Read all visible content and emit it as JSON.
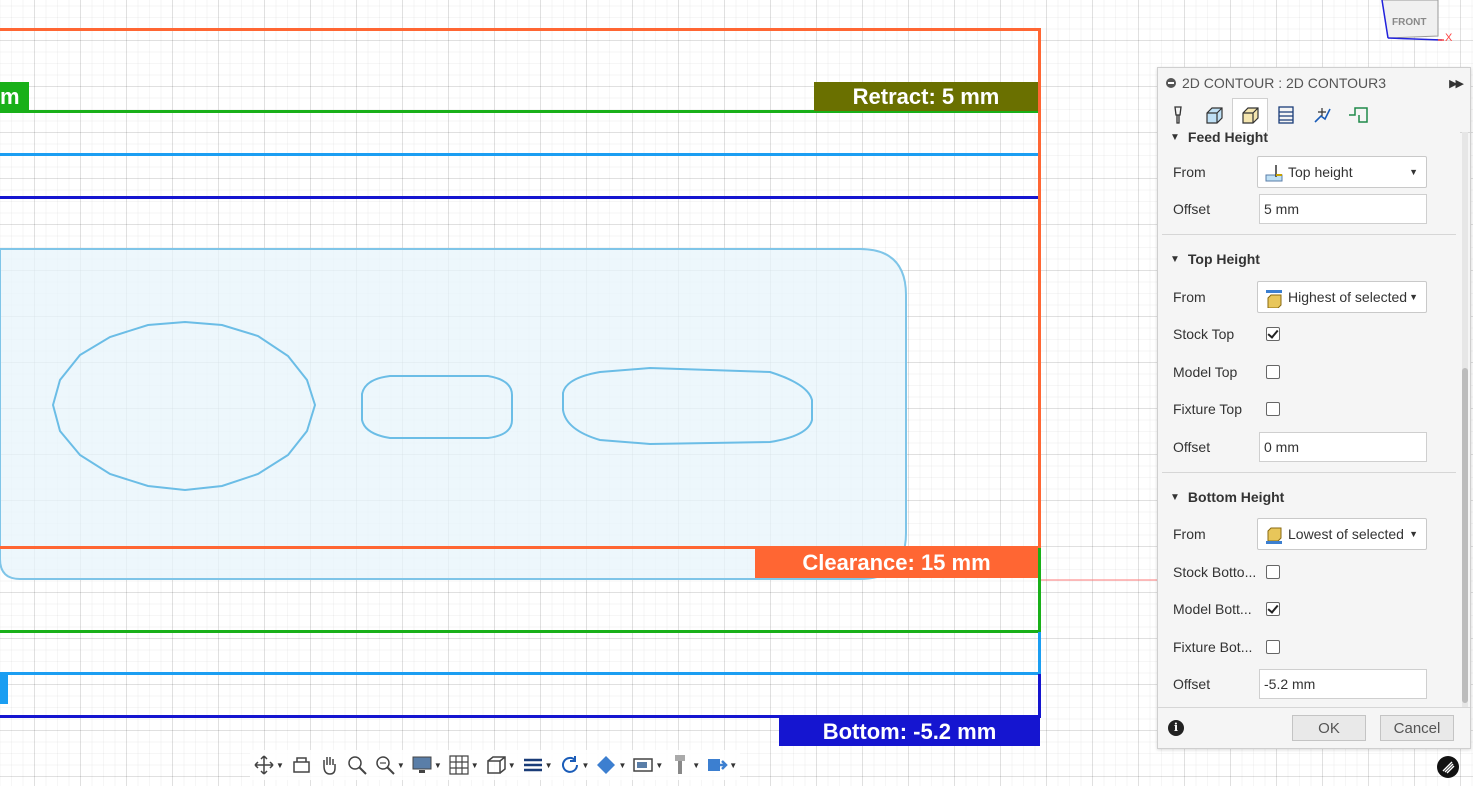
{
  "viewport": {
    "height_labels": {
      "retract": "Retract: 5 mm",
      "clearance": "Clearance: 15 mm",
      "bottom": "Bottom: -5.2 mm",
      "partial_left_top": "m"
    },
    "colors": {
      "clearance": "#ff6633",
      "retract": "#6a7000",
      "feed_green": "#19b019",
      "top_lightblue": "#1b9ef2",
      "bottom_blue": "#1515d0",
      "stock_fill": "#e7f4fb",
      "stock_stroke": "#7fc5e8"
    },
    "viewcube_label": "FRONT",
    "axis_label": "X"
  },
  "toolbar": {
    "items": [
      {
        "icon": "orbit-move-icon",
        "has_menu": true
      },
      {
        "icon": "look-at-icon",
        "has_menu": false
      },
      {
        "icon": "pan-hand-icon",
        "has_menu": false
      },
      {
        "icon": "zoom-icon",
        "has_menu": false
      },
      {
        "icon": "zoom-window-icon",
        "has_menu": true
      },
      {
        "icon": "display-settings-icon",
        "has_menu": true
      },
      {
        "icon": "grid-icon",
        "has_menu": true
      },
      {
        "icon": "viewports-icon",
        "has_menu": true
      },
      {
        "icon": "layers-icon",
        "has_menu": true
      },
      {
        "icon": "refresh-icon",
        "has_menu": true
      },
      {
        "icon": "material-icon",
        "has_menu": true
      },
      {
        "icon": "simulation-icon",
        "has_menu": true
      },
      {
        "icon": "tool-icon",
        "has_menu": true
      },
      {
        "icon": "post-icon",
        "has_menu": true
      }
    ]
  },
  "panel": {
    "title": "2D CONTOUR : 2D CONTOUR3",
    "tabs": [
      "tool-tab",
      "geometry-tab",
      "heights-tab",
      "passes-tab",
      "linking-tab",
      "post-tab"
    ],
    "active_tab": "heights-tab",
    "feed_height": {
      "section_title": "Feed Height",
      "from_label": "From",
      "from_value": "Top height",
      "offset_label": "Offset",
      "offset_value": "5 mm"
    },
    "top_height": {
      "section_title": "Top Height",
      "from_label": "From",
      "from_value": "Highest of selected",
      "stock_top_label": "Stock Top",
      "stock_top_checked": true,
      "model_top_label": "Model Top",
      "model_top_checked": false,
      "fixture_top_label": "Fixture Top",
      "fixture_top_checked": false,
      "offset_label": "Offset",
      "offset_value": "0 mm"
    },
    "bottom_height": {
      "section_title": "Bottom Height",
      "from_label": "From",
      "from_value": "Lowest of selected",
      "stock_bottom_label": "Stock Botto...",
      "stock_bottom_checked": false,
      "model_bottom_label": "Model Bott...",
      "model_bottom_checked": true,
      "fixture_bottom_label": "Fixture Bot...",
      "fixture_bottom_checked": false,
      "offset_label": "Offset",
      "offset_value": "-5.2 mm"
    },
    "ok_label": "OK",
    "cancel_label": "Cancel"
  }
}
